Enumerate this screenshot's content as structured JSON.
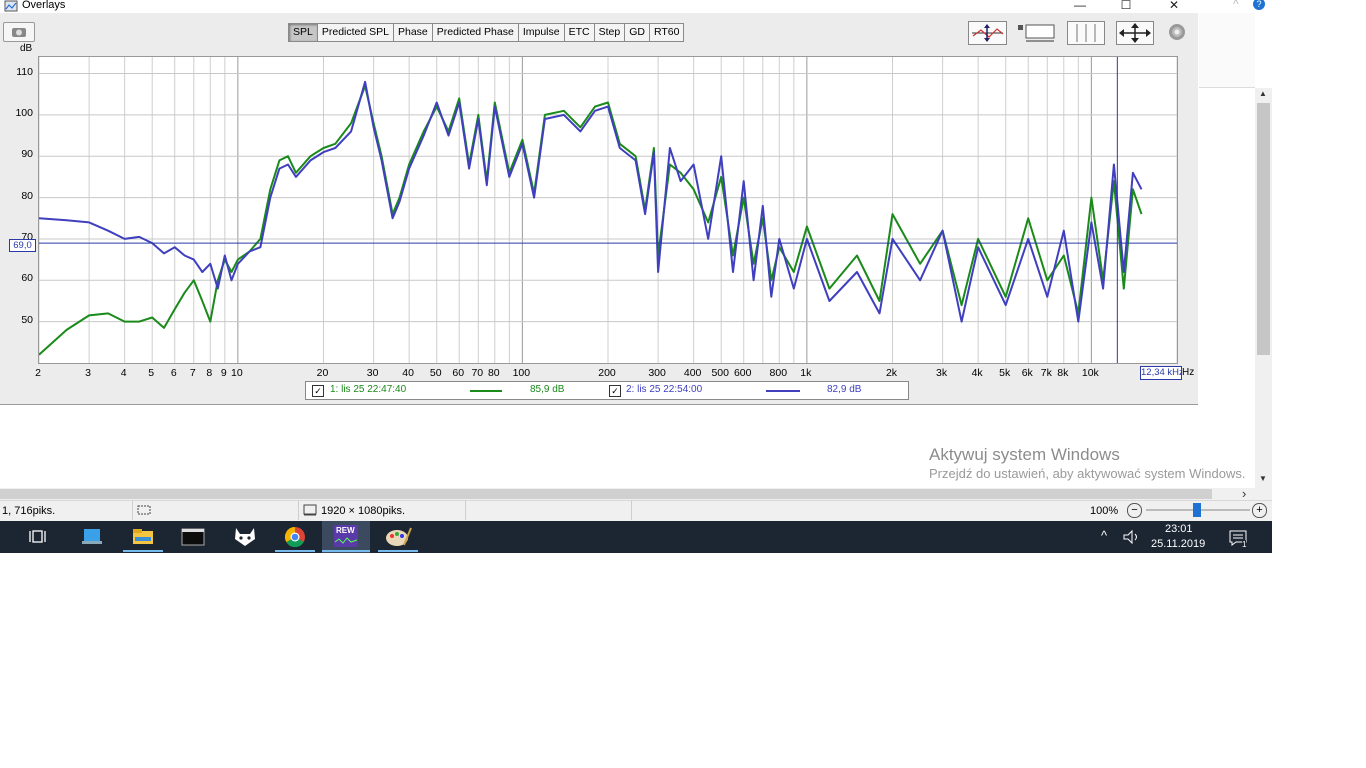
{
  "window": {
    "title": "Overlays",
    "controls": {
      "minimize": "—",
      "maximize": "☐",
      "close": "✕"
    }
  },
  "tabs": [
    "SPL",
    "Predicted SPL",
    "Phase",
    "Predicted Phase",
    "Impulse",
    "ETC",
    "Step",
    "GD",
    "RT60"
  ],
  "active_tab": "SPL",
  "toolbar_icons": [
    "y-axis-scale-icon",
    "x-axis-limits-icon",
    "grid-icon",
    "fit-all-icon",
    "settings-gear-icon"
  ],
  "chart_data": {
    "type": "line",
    "ylabel": "dB",
    "y_ticks": [
      "110",
      "100",
      "90",
      "80",
      "70",
      "60",
      "50"
    ],
    "x_ticks": [
      "2",
      "3",
      "4",
      "5",
      "6",
      "7",
      "8",
      "9",
      "10",
      "20",
      "30",
      "40",
      "50",
      "60",
      "70",
      "80",
      "100",
      "200",
      "300",
      "400",
      "500",
      "600",
      "800",
      "1k",
      "2k",
      "3k",
      "4k",
      "5k",
      "6k",
      "7k",
      "8k",
      "10k"
    ],
    "x_unit": "Hz",
    "xlim": [
      2,
      20000
    ],
    "ylim": [
      40,
      114
    ],
    "log_x": true,
    "grid": true,
    "cursor": {
      "y_label": "69,0",
      "y": 69,
      "x_label": "12,34 kHz",
      "x": 12340
    },
    "series": [
      {
        "name": "1: lis 25 22:47:40",
        "level": "85,9 dB",
        "color": "#1a8a1a",
        "x": [
          2,
          2.5,
          3,
          3.5,
          4,
          4.5,
          5,
          5.5,
          6,
          6.5,
          7,
          7.5,
          8,
          8.5,
          9,
          9.5,
          10,
          11,
          12,
          13,
          14,
          15,
          16,
          18,
          20,
          22,
          25,
          28,
          30,
          32,
          35,
          37,
          40,
          45,
          50,
          55,
          60,
          65,
          70,
          75,
          80,
          90,
          100,
          110,
          120,
          140,
          160,
          180,
          200,
          220,
          250,
          270,
          290,
          300,
          330,
          360,
          400,
          450,
          500,
          550,
          600,
          650,
          700,
          750,
          800,
          900,
          1000,
          1200,
          1500,
          1800,
          2000,
          2500,
          3000,
          3500,
          4000,
          5000,
          6000,
          7000,
          8000,
          9000,
          10000,
          11000,
          12000,
          13000,
          14000,
          15000
        ],
        "y": [
          42,
          48,
          51.5,
          52,
          50,
          50,
          51,
          48.5,
          53,
          57,
          60,
          55,
          50,
          60,
          65,
          62,
          65,
          67,
          70,
          82,
          89,
          90,
          86,
          90,
          92,
          93,
          98,
          107,
          98,
          90,
          76,
          80,
          88,
          96,
          102,
          96,
          104,
          88,
          100,
          84,
          103,
          86,
          94,
          81,
          100,
          101,
          97,
          102,
          103,
          93,
          90,
          77,
          92,
          66,
          88,
          86,
          82,
          74,
          85,
          66,
          80,
          64,
          75,
          60,
          68,
          62,
          73,
          58,
          66,
          55,
          76,
          64,
          72,
          54,
          70,
          56,
          75,
          60,
          66,
          52,
          80,
          60,
          84,
          58,
          82,
          76
        ]
      },
      {
        "name": "2: lis 25 22:54:00",
        "level": "82,9 dB",
        "color": "#3f3fbf",
        "x": [
          2,
          2.5,
          3,
          3.5,
          4,
          4.5,
          5,
          5.5,
          6,
          6.5,
          7,
          7.5,
          8,
          8.5,
          9,
          9.5,
          10,
          11,
          12,
          13,
          14,
          15,
          16,
          18,
          20,
          22,
          25,
          28,
          30,
          32,
          35,
          37,
          40,
          45,
          50,
          55,
          60,
          65,
          70,
          75,
          80,
          90,
          100,
          110,
          120,
          140,
          160,
          180,
          200,
          220,
          250,
          270,
          290,
          300,
          330,
          360,
          400,
          450,
          500,
          550,
          600,
          650,
          700,
          750,
          800,
          900,
          1000,
          1200,
          1500,
          1800,
          2000,
          2500,
          3000,
          3500,
          4000,
          5000,
          6000,
          7000,
          8000,
          9000,
          10000,
          11000,
          12000,
          13000,
          14000,
          15000
        ],
        "y": [
          75,
          74.5,
          74,
          72,
          70,
          70.5,
          69,
          66.5,
          68,
          66,
          65,
          62,
          64,
          58,
          66,
          60,
          64,
          67,
          68,
          80,
          87,
          88,
          85,
          89,
          91,
          92,
          96,
          108,
          97,
          89,
          75,
          79,
          87,
          95,
          103,
          95,
          103,
          87,
          99,
          83,
          102,
          85,
          93,
          80,
          99,
          100,
          96,
          101,
          102,
          92,
          89,
          76,
          91,
          62,
          92,
          84,
          88,
          70,
          90,
          62,
          84,
          60,
          78,
          56,
          70,
          58,
          70,
          55,
          62,
          52,
          70,
          60,
          72,
          50,
          68,
          54,
          70,
          56,
          72,
          50,
          74,
          58,
          88,
          62,
          86,
          82
        ]
      }
    ]
  },
  "right_panel": {
    "scroll_up": "▲",
    "scroll_down": "▼",
    "scroll_right": "›",
    "help": "?"
  },
  "watermark": {
    "title": "Aktywuj system Windows",
    "subtitle": "Przejdź do ustawień, aby aktywować system Windows."
  },
  "statusbar": {
    "coords": "1, 716piks.",
    "dimensions": "1920 × 1080piks.",
    "zoom": "100%",
    "zoom_out": "−",
    "zoom_in": "+"
  },
  "taskbar": {
    "apps": [
      "task-view-icon",
      "computer-icon",
      "file-explorer-icon",
      "terminal-icon",
      "cat-app-icon",
      "chrome-icon",
      "rew-icon",
      "paint-icon"
    ],
    "rew_label": "REW",
    "tray_chevron": "^",
    "time": "23:01",
    "date": "25.11.2019",
    "notification_count": "1"
  }
}
